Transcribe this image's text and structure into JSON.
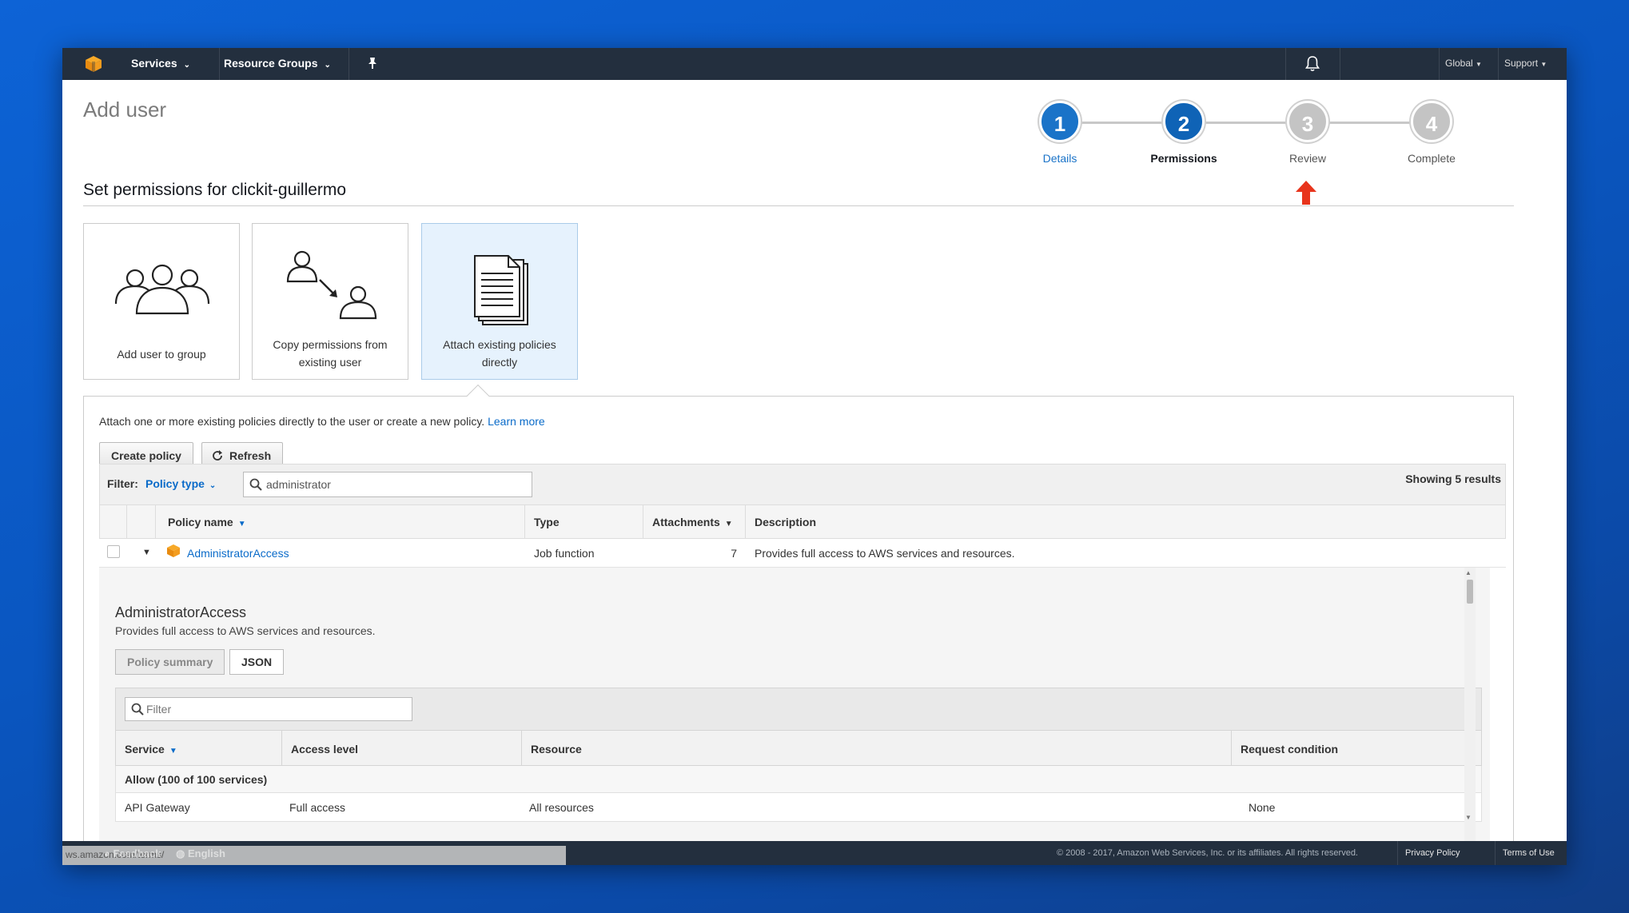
{
  "nav": {
    "services": "Services",
    "resource_groups": "Resource Groups",
    "region": "Global",
    "support": "Support"
  },
  "page_title": "Add user",
  "steps": [
    {
      "number": "1",
      "label": "Details",
      "state": "done"
    },
    {
      "number": "2",
      "label": "Permissions",
      "state": "current"
    },
    {
      "number": "3",
      "label": "Review",
      "state": "pending"
    },
    {
      "number": "4",
      "label": "Complete",
      "state": "pending"
    }
  ],
  "subtitle": "Set permissions for clickit-guillermo",
  "options": [
    {
      "label": "Add user to group",
      "selected": false
    },
    {
      "label_line1": "Copy permissions from",
      "label_line2": "existing user",
      "selected": false
    },
    {
      "label_line1": "Attach existing policies",
      "label_line2": "directly",
      "selected": true
    }
  ],
  "intro": {
    "text": "Attach one or more existing policies directly to the user or create a new policy.",
    "link": "Learn more"
  },
  "buttons": {
    "create_policy": "Create policy",
    "refresh": "Refresh"
  },
  "filter": {
    "label": "Filter:",
    "type_link": "Policy type",
    "search_value": "administrator",
    "showing": "Showing 5 results"
  },
  "table": {
    "headers": {
      "policy_name": "Policy name",
      "type": "Type",
      "attachments": "Attachments",
      "description": "Description"
    },
    "rows": [
      {
        "name": "AdministratorAccess",
        "type": "Job function",
        "attachments": "7",
        "description": "Provides full access to AWS services and resources."
      }
    ]
  },
  "details": {
    "title": "AdministratorAccess",
    "description": "Provides full access to AWS services and resources.",
    "tab_summary": "Policy summary",
    "tab_json": "JSON",
    "filter_placeholder": "Filter",
    "headers": {
      "service": "Service",
      "access_level": "Access level",
      "resource": "Resource",
      "request_condition": "Request condition"
    },
    "allow_text": "Allow (100 of 100 services)",
    "rows": [
      {
        "service": "API Gateway",
        "access_level": "Full access",
        "resource": "All resources",
        "condition": "None"
      }
    ]
  },
  "footer": {
    "feedback": "Feedback",
    "language": "English",
    "copyright": "© 2008 - 2017, Amazon Web Services, Inc. or its affiliates. All rights reserved.",
    "privacy": "Privacy Policy",
    "terms": "Terms of Use",
    "status_url": "ws.amazon.com/terms/"
  },
  "colors": {
    "nav_bg": "#232f3e",
    "step_active": "#1a73c8",
    "step_current": "#0f63b6",
    "step_pending": "#c4c4c4",
    "link": "#0a6bc9",
    "arrow": "#e8341c"
  }
}
